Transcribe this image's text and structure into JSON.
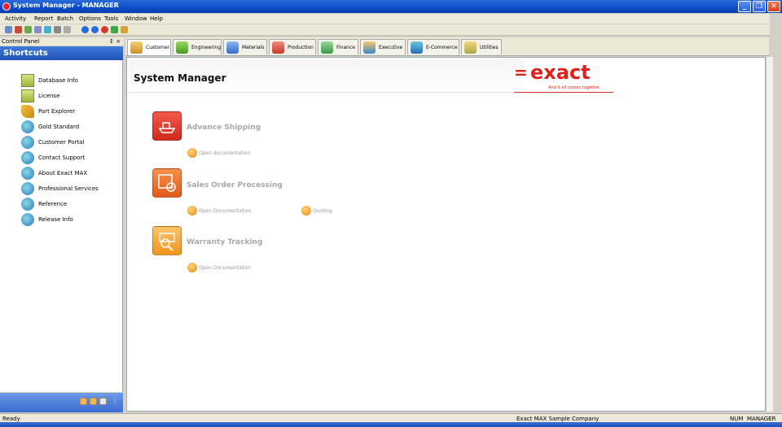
{
  "window": {
    "title": "System Manager - MANAGER"
  },
  "menu": [
    "Activity",
    "Report",
    "Batch",
    "Options",
    "Tools",
    "Window",
    "Help"
  ],
  "control_panel": {
    "label": "Control Panel",
    "pin": "↕ ×",
    "header": "Shortcuts"
  },
  "shortcuts": [
    "Database Info",
    "License",
    "Part Explorer",
    "Gold Standard",
    "Customer Portal",
    "Contact Support",
    "About Exact MAX",
    "Professional Services",
    "Reference",
    "Release Info"
  ],
  "tabs": [
    "Customer",
    "Engineering",
    "Materials",
    "Production",
    "Finance",
    "Executive",
    "E-Commerce",
    "Utilities"
  ],
  "main": {
    "title": "System Manager",
    "brand": {
      "name": "exact",
      "tagline": "And it all comes together."
    },
    "modules": [
      {
        "title": "Advance Shipping",
        "links": [
          "Open documentation"
        ]
      },
      {
        "title": "Sales Order Processing",
        "links": [
          "Open Documentation",
          "Quoting"
        ]
      },
      {
        "title": "Warranty Tracking",
        "links": [
          "Open Documentation"
        ]
      }
    ]
  },
  "status": {
    "left": "Ready",
    "company": "Exact MAX Sample Company",
    "num": "NUM",
    "user": "MANAGER"
  }
}
